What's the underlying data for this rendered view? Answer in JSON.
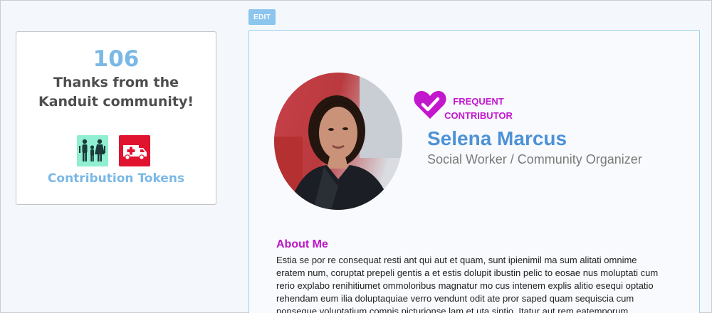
{
  "toolbar": {
    "edit_label": "EDIT"
  },
  "thanks": {
    "count": "106",
    "text": "Thanks from the Kanduit community!",
    "tokens_label": "Contribution Tokens",
    "tokens": [
      {
        "icon": "family-icon",
        "color": "#8fefd0"
      },
      {
        "icon": "ambulance-icon",
        "color": "#e0142f"
      }
    ]
  },
  "profile": {
    "badge_line1": "FREQUENT",
    "badge_line2": "CONTRIBUTOR",
    "badge_icon": "heart-check-icon",
    "badge_color": "#c317ce",
    "name": "Selena Marcus",
    "title": "Social Worker / Community Organizer",
    "about_heading": "About Me",
    "about_text": "Estia se por re consequat resti ant qui aut et quam, sunt ipienimil ma sum alitati omnime eratem num, coruptat prepeli gentis a et estis dolupit ibustin pelic to eosae nus moluptati cum rerio explabo renihitiumet ommoloribus magnatur mo cus intenem explis alitio esequi optatio rehendam eum ilia doluptaquiae verro vendunt odit ate pror saped quam sequiscia cum nonseque voluptatium comnis picturionse lam et uta sintio. Itatur aut rem eatemporum"
  },
  "colors": {
    "accent": "#7ab8e6",
    "name": "#4d92d6",
    "magenta": "#c317ce",
    "card_border": "#9fd0ec"
  }
}
